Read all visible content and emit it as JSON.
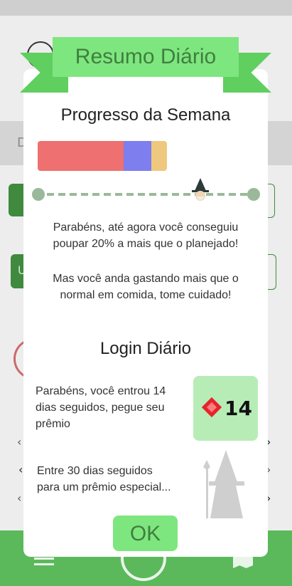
{
  "dialog": {
    "title": "Resumo Diário",
    "week_section": {
      "title": "Progresso da Semana",
      "progress_segments": [
        {
          "name": "segment-red",
          "color": "#ee7070",
          "fraction": 0.49
        },
        {
          "name": "segment-purple",
          "color": "#7e7eee",
          "fraction": 0.16
        },
        {
          "name": "segment-orange",
          "color": "#eec87e",
          "fraction": 0.09
        }
      ],
      "character_progress": 0.75,
      "message_1": "Parabéns, até agora você conseguiu poupar 20% a mais que o planejado!",
      "message_2": "Mas você anda gastando mais que o normal em comida, tome cuidado!"
    },
    "login_section": {
      "title": "Login Diário",
      "streak_message": "Parabéns, você entrou 14 dias seguidos, pegue seu prêmio",
      "reward_count": "14",
      "special_message": "Entre 30 dias seguidos para um prêmio especial..."
    },
    "ok_label": "OK"
  },
  "background": {
    "strip_letter": "D",
    "button_letter": "U"
  },
  "colors": {
    "accent_green": "#7ee67e",
    "ribbon_dark": "#5fcf5f",
    "bottom_bar": "#5bb95b"
  }
}
